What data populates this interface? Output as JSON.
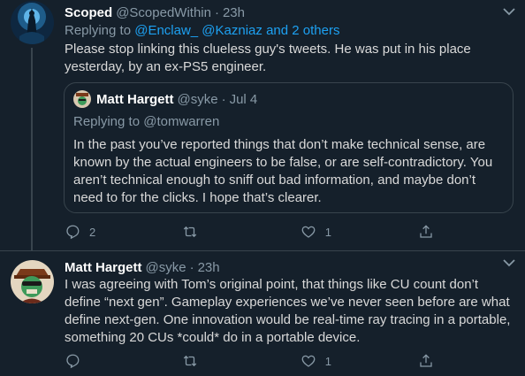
{
  "tweets": [
    {
      "display_name": "Scoped",
      "handle": "@ScopedWithin",
      "time": "23h",
      "replying_prefix": "Replying to ",
      "replying_to": "@Enclaw_ @Kazniaz and 2 others",
      "text": "Please stop linking this clueless guy's tweets. He was put in his place yesterday, by an ex-PS5 engineer.",
      "quote": {
        "display_name": "Matt Hargett",
        "handle": "@syke",
        "time": "Jul 4",
        "replying_prefix": "Replying to ",
        "replying_to": "@tomwarren",
        "text": "In the past you’ve reported things that don’t make technical sense, are known by the actual engineers to be false, or are self-contradictory. You aren’t technical enough to sniff out bad information, and maybe don’t need to for the clicks. I hope that’s clearer."
      },
      "actions": {
        "reply_count": "2",
        "retweet_count": "",
        "like_count": "1"
      }
    },
    {
      "display_name": "Matt Hargett",
      "handle": "@syke",
      "time": "23h",
      "text": "I was agreeing with Tom’s original point, that things like CU count don’t define “next gen”. Gameplay experiences we’ve never seen before are what define next-gen. One innovation would be real-time ray tracing in a portable, something 20 CUs *could* do in a portable device.",
      "actions": {
        "reply_count": "",
        "retweet_count": "",
        "like_count": "1"
      }
    }
  ],
  "icons": [
    "chevron-down-icon",
    "reply-icon",
    "retweet-icon",
    "like-icon",
    "share-icon"
  ],
  "colors": {
    "background": "#15202b",
    "link": "#1da1f2",
    "muted": "#8899a6",
    "border": "#38444d"
  }
}
